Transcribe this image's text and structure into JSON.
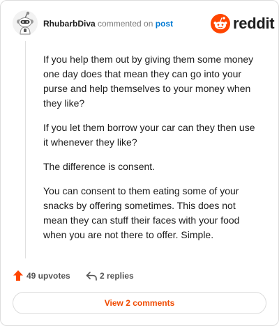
{
  "comment": {
    "author": "RhubarbDiva",
    "action": "commented on",
    "target": "post",
    "paragraphs": [
      "If you help them out by giving them some money one day does that mean they can go into your purse and help themselves to your money when they like?",
      "If you let them borrow your car can they then use it whenever they like?",
      "The difference is consent.",
      "You can consent to them eating some of your snacks by offering sometimes. This does not mean they can stuff their faces with your food when you are not there to offer. Simple."
    ],
    "upvotes": "49 upvotes",
    "replies": "2 replies",
    "view_comments_label": "View 2 comments"
  },
  "brand": {
    "wordmark": "reddit",
    "accent": "#ff4500"
  },
  "icons": {
    "avatar": "snoo-avatar-icon",
    "brand": "reddit-logo-icon",
    "upvote": "upvote-arrow-icon",
    "reply": "reply-arrow-icon"
  },
  "colors": {
    "link": "#0079d3",
    "button_text": "#f04a00",
    "muted": "#7c7c7c"
  }
}
